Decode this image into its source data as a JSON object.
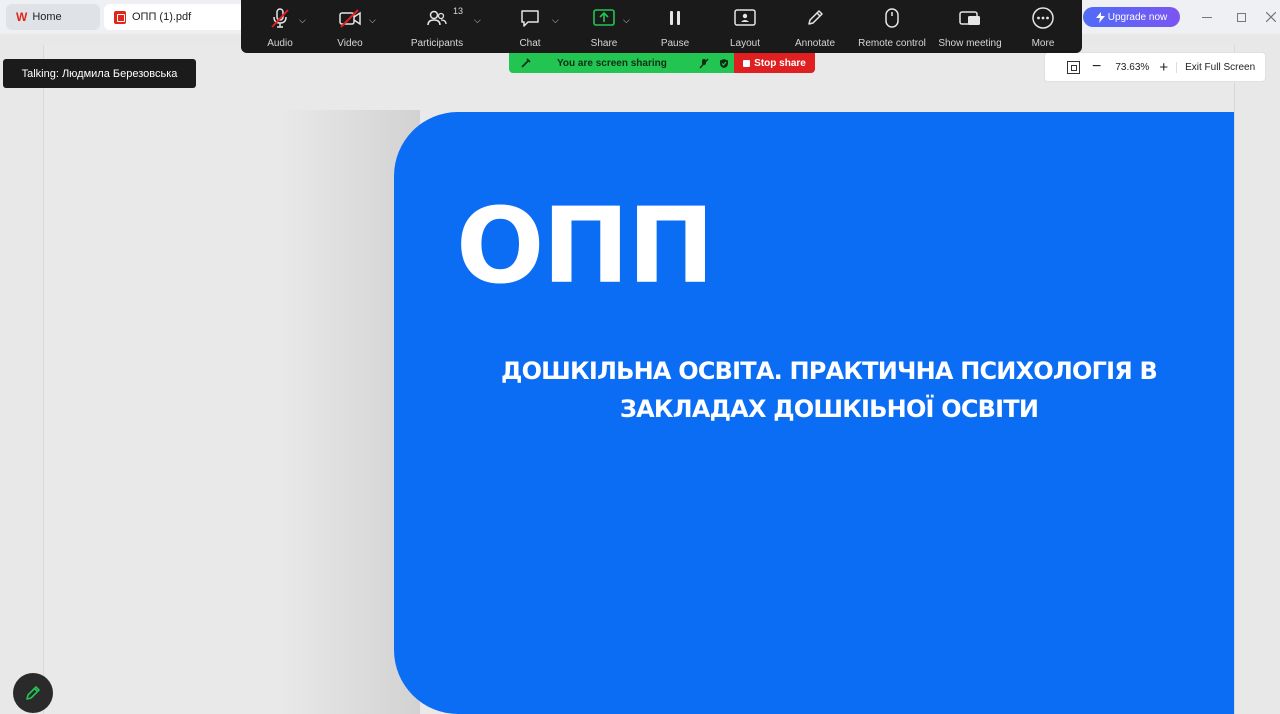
{
  "tabs": {
    "home": {
      "logo": "W",
      "label": "Home"
    },
    "pdf": {
      "label": "ОПП (1).pdf"
    }
  },
  "upgrade": {
    "label": "Upgrade now",
    "icon": "bolt-icon"
  },
  "window_controls": {
    "minimize": "minimize-icon",
    "maximize": "maximize-icon",
    "close": "close-icon"
  },
  "meeting_toolbar": {
    "items": [
      {
        "label": "Audio",
        "icon": "muted-mic-icon"
      },
      {
        "label": "Video",
        "icon": "video-off-icon"
      },
      {
        "label": "Participants",
        "icon": "participants-icon",
        "count": "13"
      },
      {
        "label": "Chat",
        "icon": "chat-icon"
      },
      {
        "label": "Share",
        "icon": "share-screen-icon"
      },
      {
        "label": "Pause",
        "icon": "pause-icon"
      },
      {
        "label": "Layout",
        "icon": "layout-icon"
      },
      {
        "label": "Annotate",
        "icon": "pencil-icon"
      },
      {
        "label": "Remote control",
        "icon": "mouse-icon"
      },
      {
        "label": "Show meeting",
        "icon": "show-meeting-icon"
      },
      {
        "label": "More",
        "icon": "more-icon"
      }
    ]
  },
  "share_banner": {
    "label": "You are screen sharing",
    "stop_label": "Stop share"
  },
  "talking": {
    "label": "Talking: Людмила Березовська"
  },
  "zoombar": {
    "zoom_value": "73.63%",
    "exit_label": "Exit Full Screen",
    "minus": "−",
    "plus": "+"
  },
  "slide": {
    "title": "ОПП",
    "subtitle": "ДОШКІЛЬНА ОСВІТА. ПРАКТИЧНА ПСИХОЛОГІЯ В ЗАКЛАДАХ ДОШКІЬНОЇ ОСВІТИ",
    "background_color": "#0b6df4"
  },
  "colors": {
    "toolbar_bg": "#1a1a1a",
    "share_green": "#23c552",
    "stop_red": "#e02020",
    "muted_red": "#e02020"
  }
}
